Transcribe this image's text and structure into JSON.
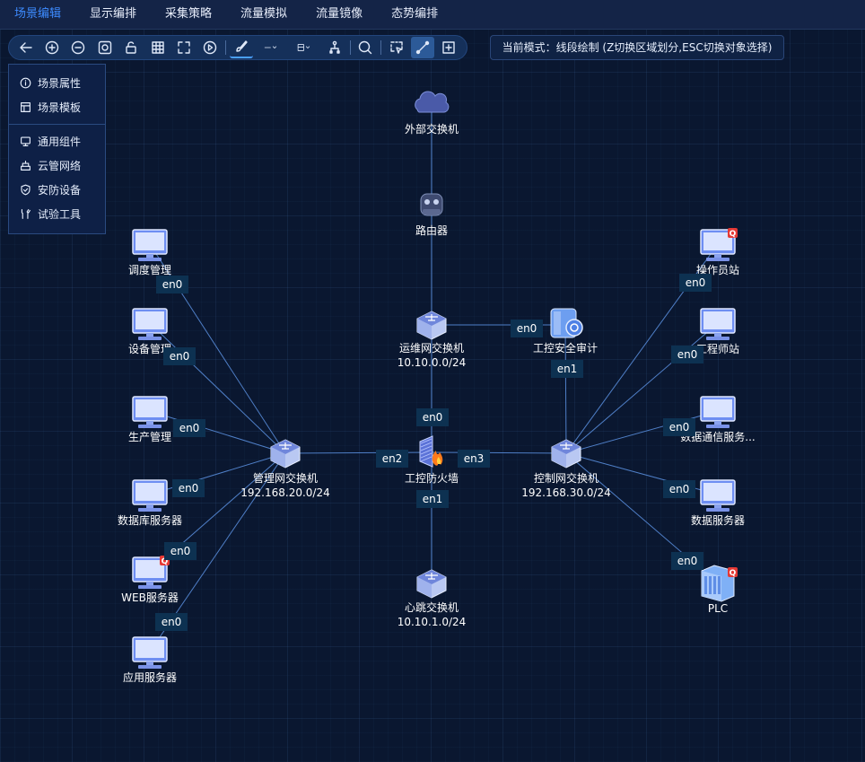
{
  "menubar": {
    "items": [
      "场景编辑",
      "显示编排",
      "采集策略",
      "流量模拟",
      "流量镜像",
      "态势编排"
    ],
    "active_index": 0
  },
  "toolbar": {
    "tools": [
      "back-arrow-icon",
      "zoom-in-icon",
      "zoom-out-icon",
      "fit-view-icon",
      "lock-icon",
      "grid-icon",
      "fullscreen-icon",
      "play-icon",
      "brush-icon",
      "line-style-icon",
      "fill-style-icon",
      "align-icon",
      "search-icon",
      "select-region-icon",
      "draw-line-icon",
      "add-frame-icon"
    ]
  },
  "mode": {
    "text": "当前模式：线段绘制 (Z切换区域划分,ESC切换对象选择)"
  },
  "sidepanel": {
    "group1": [
      {
        "label": "场景属性",
        "icon": "info-icon"
      },
      {
        "label": "场景模板",
        "icon": "template-icon"
      }
    ],
    "group2": [
      {
        "label": "通用组件",
        "icon": "monitor-icon"
      },
      {
        "label": "云管网络",
        "icon": "cloud-network-icon"
      },
      {
        "label": "安防设备",
        "icon": "shield-icon"
      },
      {
        "label": "试验工具",
        "icon": "tools-icon"
      }
    ]
  },
  "colors": {
    "accent": "#3d8bff",
    "link": "#4f7fc7",
    "port_bg": "#0d3151",
    "alert_badge": "#e53935"
  },
  "topology": {
    "nodes": [
      {
        "id": "ext-switch",
        "type": "cloud",
        "label": "外部交换机"
      },
      {
        "id": "router",
        "type": "router",
        "label": "路由器"
      },
      {
        "id": "ops-switch",
        "type": "switch",
        "label": "运维网交换机",
        "sublabel": "10.10.0.0/24"
      },
      {
        "id": "audit",
        "type": "audit",
        "label": "工控安全审计"
      },
      {
        "id": "firewall",
        "type": "firewall",
        "label": "工控防火墙"
      },
      {
        "id": "heartbeat-switch",
        "type": "switch",
        "label": "心跳交换机",
        "sublabel": "10.10.1.0/24"
      },
      {
        "id": "mgmt-switch",
        "type": "switch",
        "label": "管理网交换机",
        "sublabel": "192.168.20.0/24"
      },
      {
        "id": "ctrl-switch",
        "type": "switch",
        "label": "控制网交换机",
        "sublabel": "192.168.30.0/24"
      },
      {
        "id": "dispatch",
        "type": "pc",
        "label": "调度管理"
      },
      {
        "id": "device-mgmt",
        "type": "pc",
        "label": "设备管理"
      },
      {
        "id": "production",
        "type": "pc",
        "label": "生产管理"
      },
      {
        "id": "db-server",
        "type": "pc",
        "label": "数据库服务器"
      },
      {
        "id": "web-server",
        "type": "pc",
        "label": "WEB服务器",
        "badge": "Q"
      },
      {
        "id": "app-server",
        "type": "pc",
        "label": "应用服务器"
      },
      {
        "id": "operator",
        "type": "pc",
        "label": "操作员站",
        "badge": "Q"
      },
      {
        "id": "engineer",
        "type": "pc",
        "label": "工程师站"
      },
      {
        "id": "data-comm",
        "type": "pc",
        "label": "数据通信服务..."
      },
      {
        "id": "data-server",
        "type": "pc",
        "label": "数据服务器"
      },
      {
        "id": "plc",
        "type": "plc",
        "label": "PLC",
        "badge": "Q"
      }
    ],
    "ports": [
      "en0",
      "en0",
      "en0",
      "en0",
      "en0",
      "en0",
      "en0",
      "en0",
      "en0",
      "en0",
      "en0",
      "en0",
      "en0",
      "en1",
      "en2",
      "en3",
      "en1"
    ]
  }
}
